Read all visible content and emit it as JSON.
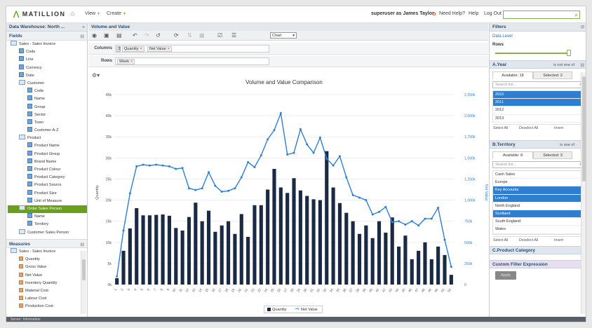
{
  "app": {
    "logo": "MATILLION",
    "nav_home": "home-icon",
    "nav_view": "View",
    "nav_create": "Create",
    "user": "superuser as James Taylor",
    "help_need": "Need Help?",
    "help": "Help",
    "logout": "Log Out",
    "search_value": ""
  },
  "left": {
    "header": "Data Warehouse: North ...",
    "fields_title": "Fields",
    "measures_title": "Measures",
    "fields": [
      {
        "label": "Sales - Sales Invoice",
        "lvl": 0,
        "type": "tbl"
      },
      {
        "label": "Code",
        "lvl": 1
      },
      {
        "label": "Line",
        "lvl": 1
      },
      {
        "label": "Currency",
        "lvl": 1
      },
      {
        "label": "Date",
        "lvl": 1
      },
      {
        "label": "Customer",
        "lvl": 1,
        "type": "tbl"
      },
      {
        "label": "Code",
        "lvl": 2
      },
      {
        "label": "Name",
        "lvl": 2
      },
      {
        "label": "Group",
        "lvl": 2
      },
      {
        "label": "Sector",
        "lvl": 2
      },
      {
        "label": "Town",
        "lvl": 2
      },
      {
        "label": "Customer A-Z",
        "lvl": 2
      },
      {
        "label": "Product",
        "lvl": 1,
        "type": "tbl"
      },
      {
        "label": "Product Name",
        "lvl": 2
      },
      {
        "label": "Product Group",
        "lvl": 2
      },
      {
        "label": "Brand Name",
        "lvl": 2
      },
      {
        "label": "Product Colour",
        "lvl": 2
      },
      {
        "label": "Product Category",
        "lvl": 2
      },
      {
        "label": "Product Source",
        "lvl": 2
      },
      {
        "label": "Product Size",
        "lvl": 2
      },
      {
        "label": "Unit of Measure",
        "lvl": 2
      },
      {
        "label": "Order Sales Person",
        "lvl": 1,
        "type": "tbl",
        "sel": true
      },
      {
        "label": "Name",
        "lvl": 2
      },
      {
        "label": "Territory",
        "lvl": 2
      },
      {
        "label": "Customer Sales Person",
        "lvl": 1,
        "type": "tbl"
      }
    ],
    "measures": [
      {
        "label": "Sales - Sales Invoice",
        "lvl": 0,
        "type": "tbl"
      },
      {
        "label": "Quantity",
        "lvl": 1
      },
      {
        "label": "Gross Value",
        "lvl": 1
      },
      {
        "label": "Net Value",
        "lvl": 1
      },
      {
        "label": "Inventory Quantity",
        "lvl": 1
      },
      {
        "label": "Material Cost",
        "lvl": 1
      },
      {
        "label": "Labour Cost",
        "lvl": 1
      },
      {
        "label": "Production Cost",
        "lvl": 1
      }
    ]
  },
  "center": {
    "header": "Volume and Value",
    "chart_type_select": "Chart",
    "columns_label": "Columns",
    "rows_label": "Rows",
    "columns": [
      "Quantity",
      "Net Value"
    ],
    "rows": [
      "Week"
    ],
    "settings_icon": "gear-icon"
  },
  "right": {
    "header": "Filters",
    "data_level": "Data Level",
    "rows_label": "Rows",
    "year": {
      "title": "A.Year",
      "op": "is not one of",
      "tab_available": "Available: 18",
      "tab_selected": "Selected: 2",
      "search_placeholder": "Search list...",
      "items": [
        "2010",
        "2011",
        "2012",
        "2013"
      ],
      "selected": [
        0,
        1
      ]
    },
    "territory": {
      "title": "B.Territory",
      "op": "is one of",
      "tab_available": "Available: 8",
      "tab_selected": "Selected: 3",
      "search_placeholder": "Search list...",
      "items": [
        "Cash Sales",
        "Europe",
        "Key Accounts",
        "London",
        "North England",
        "Scotland",
        "South England",
        "Wales"
      ],
      "selected": [
        2,
        3,
        5
      ]
    },
    "product_category": {
      "title": "C.Product Category"
    },
    "custom_filter": "Custom Filter Expression",
    "apply": "Apply",
    "select_all": "Select All",
    "deselect_all": "Deselect All",
    "invert": "Invert"
  },
  "status": "Server: Information",
  "chart_data": {
    "type": "bar+line",
    "title": "Volume and Value Comparison",
    "xlabel": "",
    "ylabel": "Quantity",
    "y2label": "Net Value",
    "categories": [
      "1",
      "2",
      "3",
      "4",
      "5",
      "6",
      "7",
      "8",
      "9",
      "10",
      "11",
      "12",
      "13",
      "14",
      "15",
      "16",
      "17",
      "18",
      "19",
      "20",
      "21",
      "22",
      "23",
      "24",
      "25",
      "26",
      "27",
      "28",
      "29",
      "30",
      "31",
      "32",
      "33",
      "34",
      "35",
      "36",
      "37",
      "38",
      "39",
      "40",
      "41",
      "42",
      "43",
      "44",
      "45",
      "46",
      "47",
      "48",
      "49",
      "50",
      "51",
      "52"
    ],
    "ylim": [
      0,
      45000
    ],
    "y2lim": [
      0,
      2250000
    ],
    "yticks": [
      "0k",
      "5k",
      "10k",
      "15k",
      "20k",
      "25k",
      "30k",
      "35k",
      "40k",
      "45k"
    ],
    "y2ticks": [
      "0",
      "250k",
      "500k",
      "750k",
      "1,000k",
      "1,250k",
      "1,500k",
      "1,750k",
      "2,000k",
      "2,250k"
    ],
    "series": [
      {
        "name": "Quantity",
        "type": "bar",
        "color": "#1a2a44",
        "values": [
          1500,
          8000,
          13300,
          18100,
          16400,
          16400,
          16500,
          16600,
          16300,
          13400,
          12800,
          16000,
          19400,
          15000,
          17500,
          12500,
          14000,
          15000,
          12000,
          16700,
          11300,
          18800,
          18800,
          22500,
          27400,
          23000,
          21700,
          25200,
          22300,
          21000,
          20200,
          20000,
          31600,
          23000,
          19300,
          17000,
          15000,
          12000,
          14000,
          11000,
          15000,
          12300,
          15900,
          9000,
          11600,
          6000,
          8000,
          10000,
          6000,
          9000,
          7000,
          2300
        ],
        "legend": "Quantity"
      },
      {
        "name": "Net Value",
        "type": "line",
        "color": "#2f7fd1",
        "values": [
          95000,
          640000,
          1080000,
          1400000,
          1420000,
          1410000,
          1420000,
          1410000,
          1400000,
          1370000,
          1380000,
          1140000,
          1120000,
          1140000,
          1330000,
          1170000,
          1100000,
          1110000,
          1140000,
          1270000,
          1450000,
          1390000,
          1530000,
          1720000,
          1830000,
          2030000,
          1540000,
          1560000,
          1840000,
          1660000,
          1560000,
          1740000,
          1490000,
          1410000,
          1520000,
          1270000,
          1060000,
          1030000,
          1000000,
          830000,
          860000,
          920000,
          740000,
          750000,
          710000,
          750000,
          700000,
          780000,
          780000,
          910000,
          530000,
          210000
        ],
        "legend": "Net Value"
      }
    ],
    "legend_position": "bottom",
    "grid": true
  }
}
